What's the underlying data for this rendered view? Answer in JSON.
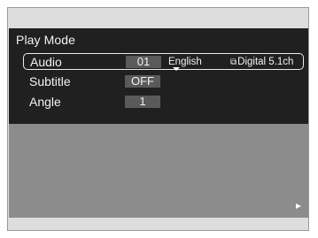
{
  "header": {
    "title": "Play Mode"
  },
  "rows": [
    {
      "label": "Audio",
      "value": "01",
      "language": "English",
      "format": "Digital 5.1ch",
      "format_icon": "dolby-icon"
    },
    {
      "label": "Subtitle",
      "value": "OFF"
    },
    {
      "label": "Angle",
      "value": "1"
    }
  ],
  "indicators": {
    "play_icon": "play-icon"
  }
}
